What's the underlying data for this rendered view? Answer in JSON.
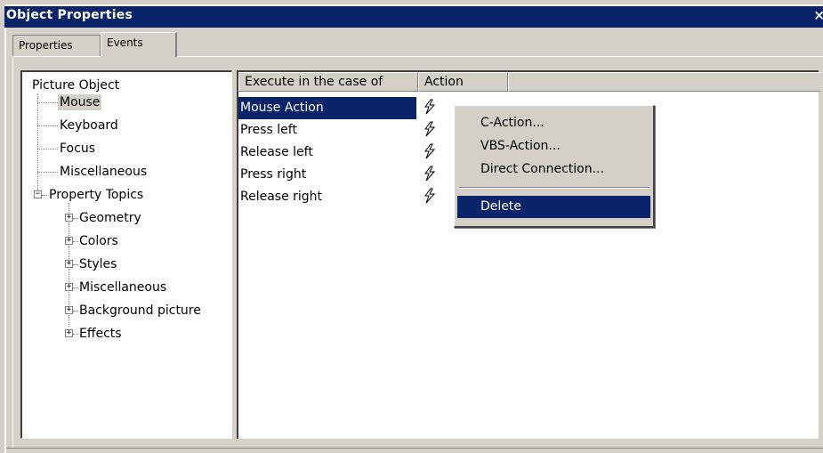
{
  "window": {
    "title": "Object Properties",
    "close_glyph": "×"
  },
  "tabs": [
    {
      "label": "Properties",
      "active": false
    },
    {
      "label": "Events",
      "active": true
    }
  ],
  "tree": {
    "root": "Picture Object",
    "event_nodes": [
      "Mouse",
      "Keyboard",
      "Focus",
      "Miscellaneous"
    ],
    "selected": "Mouse",
    "group": {
      "label": "Property Topics",
      "expanded": true,
      "children": [
        "Geometry",
        "Colors",
        "Styles",
        "Miscellaneous",
        "Background picture",
        "Effects"
      ]
    },
    "expander_collapsed": "+",
    "expander_expanded": "−"
  },
  "grid": {
    "columns": [
      "Execute in the case of",
      "Action"
    ],
    "rows": [
      {
        "event": "Mouse Action",
        "selected": true,
        "icon": "lightning-action-icon"
      },
      {
        "event": "Press left",
        "selected": false,
        "icon": "lightning-action-icon"
      },
      {
        "event": "Release left",
        "selected": false,
        "icon": "lightning-action-icon"
      },
      {
        "event": "Press right",
        "selected": false,
        "icon": "lightning-action-icon"
      },
      {
        "event": "Release right",
        "selected": false,
        "icon": "lightning-action-icon"
      }
    ]
  },
  "context_menu": {
    "items": [
      "C-Action...",
      "VBS-Action...",
      "Direct Connection..."
    ],
    "delete_label": "Delete",
    "highlighted": "Delete"
  },
  "colors": {
    "titlebar": "#0a246a",
    "selection": "#0a246a",
    "face": "#d4d0c8"
  }
}
